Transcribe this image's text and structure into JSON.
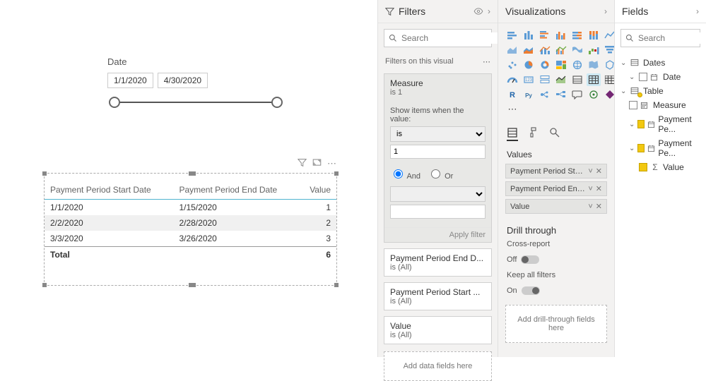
{
  "slicer": {
    "title": "Date",
    "start": "1/1/2020",
    "end": "4/30/2020"
  },
  "table": {
    "headers": [
      "Payment Period Start Date",
      "Payment Period End Date",
      "Value"
    ],
    "rows": [
      [
        "1/1/2020",
        "1/15/2020",
        "1"
      ],
      [
        "2/2/2020",
        "2/28/2020",
        "2"
      ],
      [
        "3/3/2020",
        "3/26/2020",
        "3"
      ]
    ],
    "total_label": "Total",
    "total_value": "6"
  },
  "filters": {
    "header": "Filters",
    "search_placeholder": "Search",
    "section": "Filters on this visual",
    "measure": {
      "title": "Measure",
      "sub": "is 1",
      "show_label": "Show items when the value:",
      "op": "is",
      "val": "1",
      "and": "And",
      "or": "Or",
      "apply": "Apply filter"
    },
    "cards": [
      {
        "title": "Payment Period End D...",
        "sub": "is (All)"
      },
      {
        "title": "Payment Period Start ...",
        "sub": "is (All)"
      },
      {
        "title": "Value",
        "sub": "is (All)"
      }
    ],
    "add": "Add data fields here"
  },
  "viz": {
    "header": "Visualizations",
    "values_label": "Values",
    "wells": [
      "Payment Period Start Da",
      "Payment Period End Dat",
      "Value"
    ],
    "drill_header": "Drill through",
    "cross_label": "Cross-report",
    "off": "Off",
    "keep_label": "Keep all filters",
    "on": "On",
    "add_drill": "Add drill-through fields here"
  },
  "fields": {
    "header": "Fields",
    "search_placeholder": "Search",
    "tables": {
      "dates": "Dates",
      "date": "Date",
      "table": "Table",
      "measure": "Measure",
      "pp1": "Payment Pe...",
      "pp2": "Payment Pe...",
      "value": "Value"
    }
  }
}
